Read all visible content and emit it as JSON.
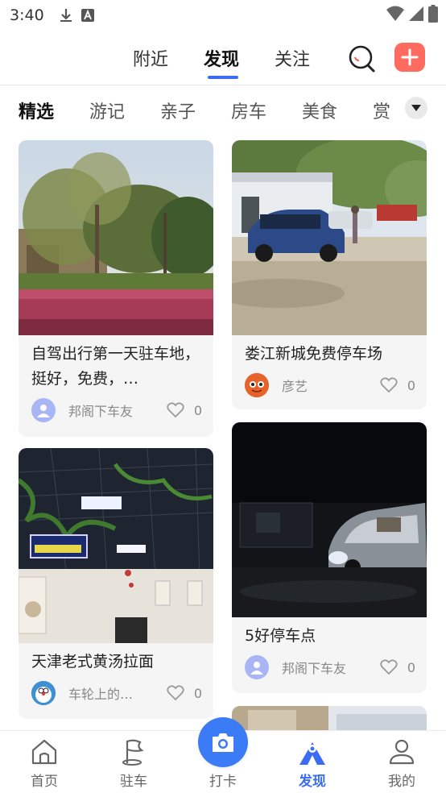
{
  "status_bar": {
    "time": "3:40"
  },
  "top_nav": {
    "tabs": [
      {
        "label": "附近"
      },
      {
        "label": "发现",
        "active": true
      },
      {
        "label": "关注"
      }
    ],
    "accent_color": "#3b6cf6",
    "add_color": "#ff6b5e"
  },
  "categories": {
    "items": [
      "精选",
      "游记",
      "亲子",
      "房车",
      "美食",
      "赏"
    ],
    "active": "精选"
  },
  "feed": {
    "cards": [
      {
        "title": "自驾出行第一天驻车地，挺好，免费，…",
        "author": "邦阁下车友",
        "likes": "0",
        "image": "trees-and-flowers-photo",
        "avatar": "default-user-avatar"
      },
      {
        "title": "娄江新城免费停车场",
        "author": "彦艺",
        "likes": "0",
        "image": "blue-suv-parking-photo",
        "avatar": "orange-fish-avatar"
      },
      {
        "title": "天津老式黄汤拉面",
        "author": "车轮上的…",
        "likes": "0",
        "image": "restaurant-interior-photo",
        "avatar": "cartoon-cat-avatar"
      },
      {
        "title": "5好停车点",
        "author": "邦阁下车友",
        "likes": "0",
        "image": "rv-at-night-photo",
        "avatar": "default-user-avatar"
      }
    ]
  },
  "bottom_nav": {
    "items": [
      {
        "label": "首页",
        "icon": "home-icon"
      },
      {
        "label": "驻车",
        "icon": "flag-icon"
      },
      {
        "label": "打卡",
        "icon": "camera-icon"
      },
      {
        "label": "发现",
        "icon": "mountain-icon",
        "active": true
      },
      {
        "label": "我的",
        "icon": "user-icon"
      }
    ]
  }
}
